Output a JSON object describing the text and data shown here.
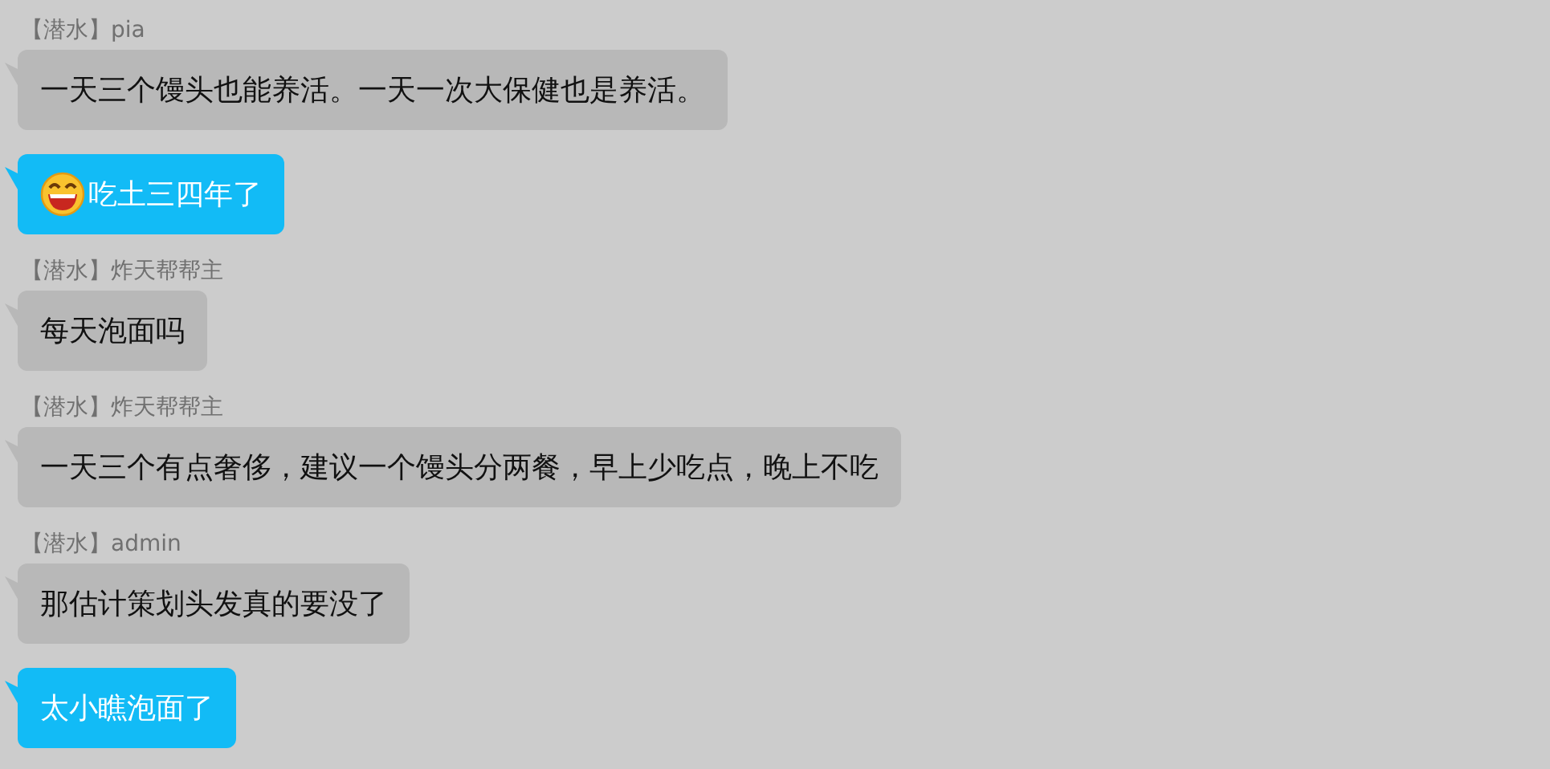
{
  "messages": [
    {
      "kind": "other",
      "sender": "【潜水】pia",
      "text": "一天三个馒头也能养活。一天一次大保健也是养活。"
    },
    {
      "kind": "self",
      "emoji": true,
      "text": "吃土三四年了"
    },
    {
      "kind": "other",
      "sender": "【潜水】炸天帮帮主",
      "text": "每天泡面吗"
    },
    {
      "kind": "other",
      "sender": "【潜水】炸天帮帮主",
      "text": "一天三个有点奢侈，建议一个馒头分两餐，早上少吃点，晚上不吃"
    },
    {
      "kind": "other",
      "sender": "【潜水】admin",
      "text": "那估计策划头发真的要没了"
    },
    {
      "kind": "self",
      "emoji": false,
      "text": "太小瞧泡面了"
    }
  ]
}
